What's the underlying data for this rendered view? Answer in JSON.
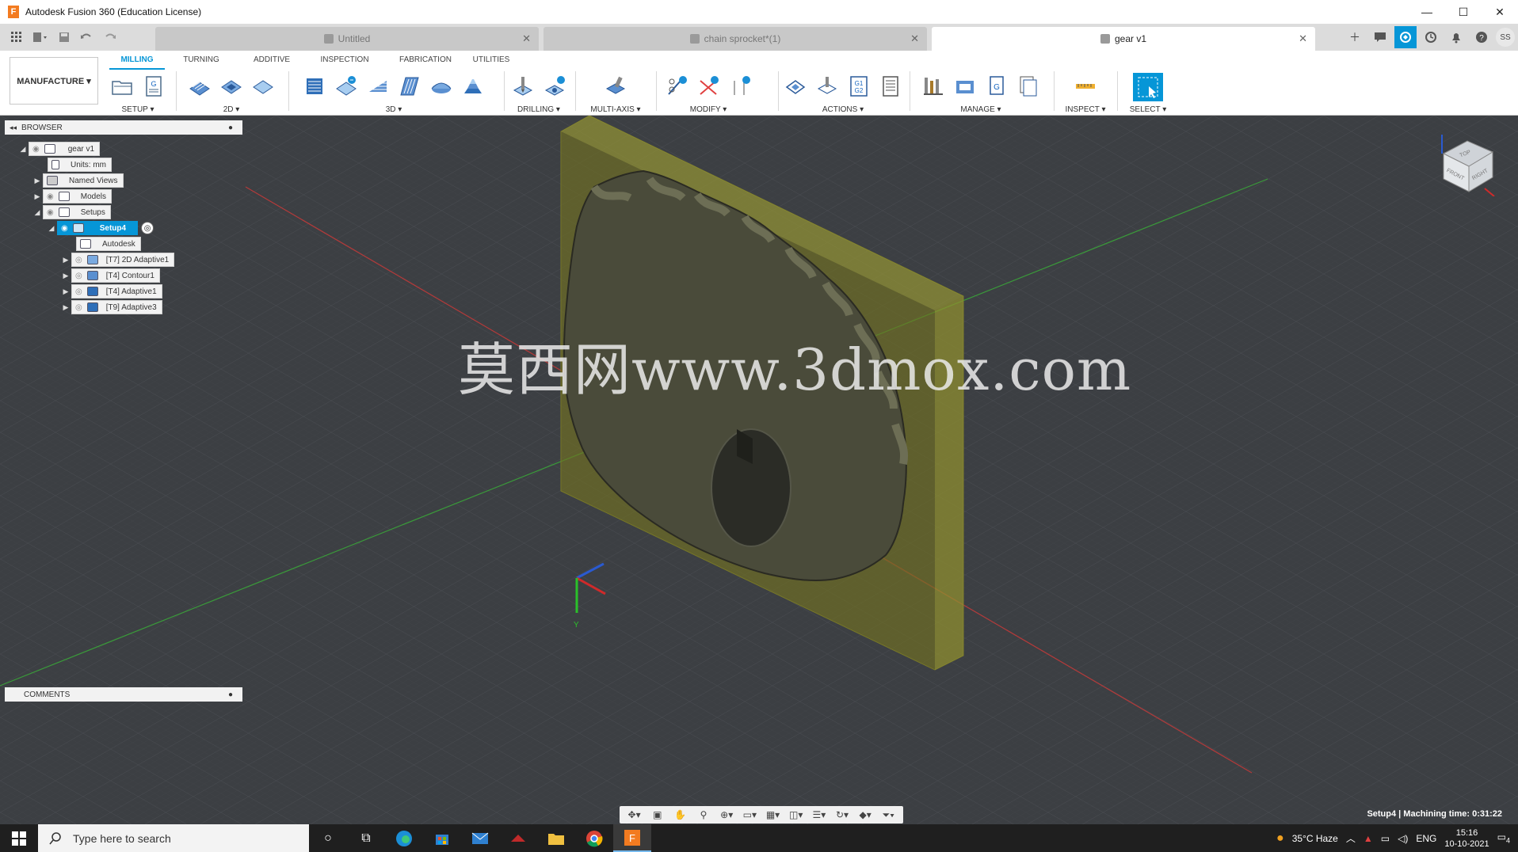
{
  "window": {
    "title": "Autodesk Fusion 360 (Education License)",
    "logo_letter": "F",
    "controls": [
      "—",
      "☐",
      "✕"
    ]
  },
  "tabs": [
    {
      "label": "Untitled",
      "active": false
    },
    {
      "label": "chain sprocket*(1)",
      "active": false
    },
    {
      "label": "gear v1",
      "active": true
    }
  ],
  "user": {
    "initials": "SS"
  },
  "ribbon": {
    "workspace": "MANUFACTURE ▾",
    "tabs": [
      "MILLING",
      "TURNING",
      "ADDITIVE",
      "INSPECTION",
      "FABRICATION",
      "UTILITIES"
    ],
    "active_tab": "MILLING",
    "groups": [
      "SETUP ▾",
      "2D ▾",
      "3D ▾",
      "DRILLING ▾",
      "MULTI-AXIS ▾",
      "MODIFY ▾",
      "ACTIONS ▾",
      "MANAGE ▾",
      "INSPECT ▾",
      "SELECT ▾"
    ]
  },
  "browser": {
    "title": "BROWSER",
    "nodes": [
      {
        "label": "gear v1"
      },
      {
        "label": "Units: mm"
      },
      {
        "label": "Named Views"
      },
      {
        "label": "Models"
      },
      {
        "label": "Setups"
      },
      {
        "label": "Setup4"
      },
      {
        "label": "Autodesk"
      },
      {
        "label": "[T7] 2D Adaptive1"
      },
      {
        "label": "[T4] Contour1"
      },
      {
        "label": "[T4] Adaptive1"
      },
      {
        "label": "[T9] Adaptive3"
      }
    ]
  },
  "viewport": {
    "watermark": "莫西网www.3dmox.com",
    "axis_label_y": "Y",
    "viewcube": {
      "top": "TOP",
      "front": "FRONT",
      "right": "RIGHT"
    }
  },
  "comments": {
    "title": "COMMENTS"
  },
  "status": {
    "text": "Setup4 | Machining time: 0:31:22"
  },
  "taskbar": {
    "search_placeholder": "Type here to search",
    "weather": "35°C  Haze",
    "language": "ENG",
    "time": "15:16",
    "date": "10-10-2021",
    "notifications": "4"
  },
  "colors": {
    "accent": "#0696d7",
    "viewport_bg": "#3c3f43",
    "stock": "#8a8a2a"
  }
}
